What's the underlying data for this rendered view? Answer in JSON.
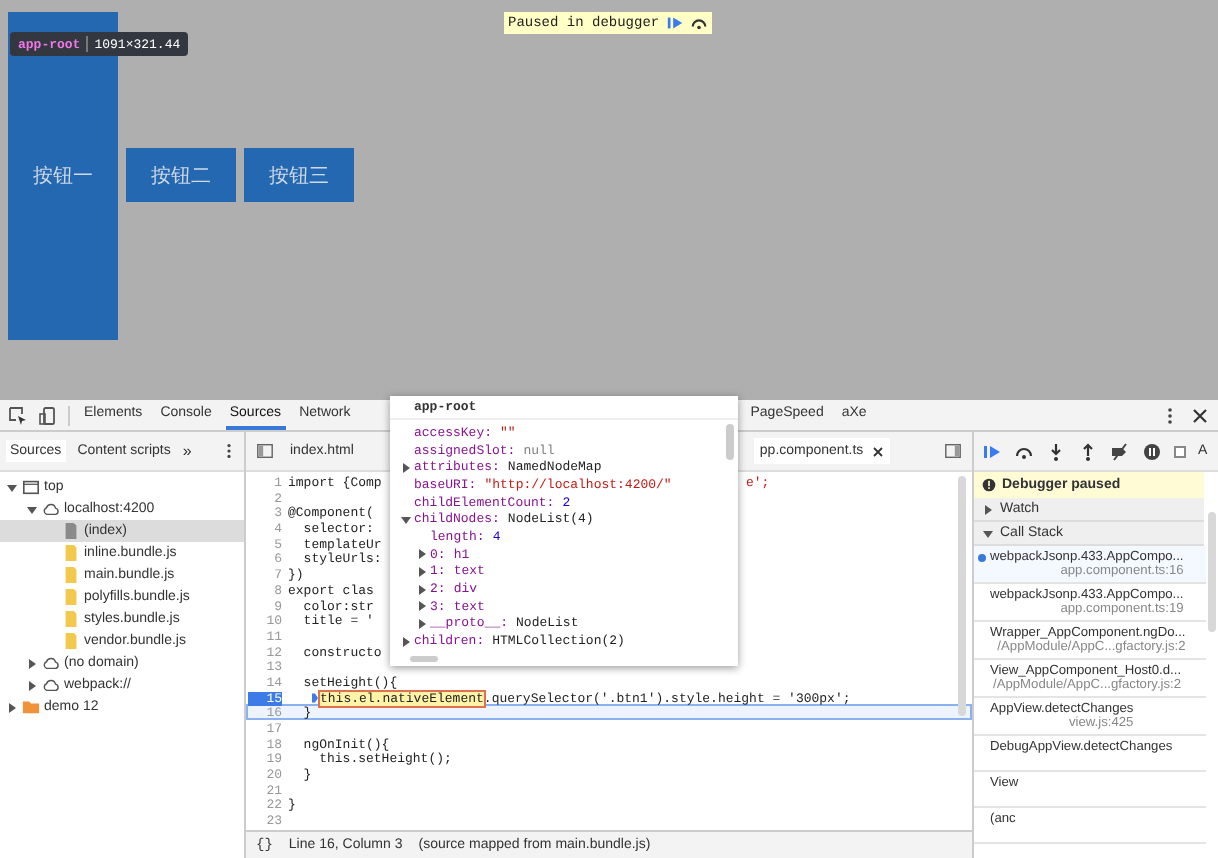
{
  "page": {
    "debug_badge": {
      "text": "Paused in debugger"
    },
    "element_tooltip": {
      "tag": "app-root",
      "size": "1091×321.44"
    },
    "buttons": [
      {
        "label": "按钮一",
        "kind": "tall"
      },
      {
        "label": "按钮二",
        "kind": "short"
      },
      {
        "label": "按钮三",
        "kind": "short"
      }
    ]
  },
  "devtools": {
    "tabs": [
      {
        "label": "Elements",
        "selected": false
      },
      {
        "label": "Console",
        "selected": false
      },
      {
        "label": "Sources",
        "selected": true
      },
      {
        "label": "Network",
        "selected": false
      },
      {
        "label": "PageSpeed",
        "selected": false
      },
      {
        "label": "aXe",
        "selected": false
      }
    ],
    "navigator": {
      "tabs": [
        {
          "label": "Sources",
          "selected": true
        },
        {
          "label": "Content scripts",
          "selected": false
        }
      ],
      "more": "»",
      "tree": [
        {
          "label": "top",
          "kind": "frame",
          "expanded": true,
          "selected": false,
          "children": [
            {
              "label": "localhost:4200",
              "kind": "cloud",
              "expanded": true,
              "selected": false,
              "children": [
                {
                  "label": "(index)",
                  "kind": "page",
                  "selected": true
                },
                {
                  "label": "inline.bundle.js",
                  "kind": "script",
                  "selected": false
                },
                {
                  "label": "main.bundle.js",
                  "kind": "script",
                  "selected": false
                },
                {
                  "label": "polyfills.bundle.js",
                  "kind": "script",
                  "selected": false
                },
                {
                  "label": "styles.bundle.js",
                  "kind": "script",
                  "selected": false
                },
                {
                  "label": "vendor.bundle.js",
                  "kind": "script",
                  "selected": false
                }
              ]
            },
            {
              "label": "(no domain)",
              "kind": "cloud",
              "expanded": false,
              "selected": false
            },
            {
              "label": "webpack://",
              "kind": "cloud",
              "expanded": false,
              "selected": false
            }
          ]
        },
        {
          "label": "demo 12",
          "kind": "folder",
          "expanded": false,
          "selected": false
        }
      ]
    },
    "editor": {
      "tabs": [
        {
          "label": "index.html",
          "selected": false
        },
        {
          "label": "pp.component.ts",
          "selected": true
        }
      ],
      "lines": [
        {
          "num": "1",
          "text": "import {Comp",
          "tail": "e';",
          "breakpoint": false,
          "current": false
        },
        {
          "num": "2",
          "breakpoint": false,
          "current": false
        },
        {
          "num": "3",
          "text": "@Component(",
          "breakpoint": false,
          "current": false
        },
        {
          "num": "4",
          "text": "  selector:",
          "breakpoint": false,
          "current": false
        },
        {
          "num": "5",
          "text": "  templateUr",
          "breakpoint": false,
          "current": false
        },
        {
          "num": "6",
          "text": "  styleUrls:",
          "breakpoint": false,
          "current": false
        },
        {
          "num": "7",
          "text": "})",
          "breakpoint": false,
          "current": false
        },
        {
          "num": "8",
          "text": "export clas",
          "breakpoint": false,
          "current": false
        },
        {
          "num": "9",
          "text": "  color:str",
          "breakpoint": false,
          "current": false
        },
        {
          "num": "10",
          "text": "  title = '",
          "breakpoint": false,
          "current": false
        },
        {
          "num": "11",
          "breakpoint": false,
          "current": false
        },
        {
          "num": "12",
          "text": "  constructo",
          "breakpoint": false,
          "current": false
        },
        {
          "num": "13",
          "breakpoint": false,
          "current": false
        },
        {
          "num": "14",
          "text": "  setHeight(){",
          "breakpoint": false,
          "current": false
        },
        {
          "num": "15",
          "highlight": "this.el.nativeElement",
          "text": ".querySelector('.btn1').style.height = '300px';",
          "breakpoint": true,
          "current": false
        },
        {
          "num": "16",
          "text": "  }",
          "breakpoint": false,
          "current": true
        },
        {
          "num": "17",
          "breakpoint": false,
          "current": false
        },
        {
          "num": "18",
          "text": "  ngOnInit(){",
          "breakpoint": false,
          "current": false
        },
        {
          "num": "19",
          "text": "    this.setHeight();",
          "breakpoint": false,
          "current": false
        },
        {
          "num": "20",
          "text": "  }",
          "breakpoint": false,
          "current": false
        },
        {
          "num": "21",
          "breakpoint": false,
          "current": false
        },
        {
          "num": "22",
          "text": "}",
          "breakpoint": false,
          "current": false
        },
        {
          "num": "23",
          "breakpoint": false,
          "current": false
        }
      ],
      "status": {
        "braces": "{}",
        "position": "Line 16, Column 3",
        "source": "(source mapped from main.bundle.js)"
      }
    },
    "popover": {
      "title": "app-root",
      "properties": [
        {
          "name": "accessKey:",
          "value": "\"\"",
          "kind": "string"
        },
        {
          "name": "assignedSlot:",
          "value": "null",
          "kind": "null"
        },
        {
          "name": "attributes:",
          "value": "NamedNodeMap",
          "kind": "object",
          "expanded": false
        },
        {
          "name": "baseURI:",
          "value": "\"http://localhost:4200/\"",
          "kind": "string"
        },
        {
          "name": "childElementCount:",
          "value": "2",
          "kind": "number"
        },
        {
          "name": "childNodes:",
          "value": "NodeList(4)",
          "kind": "object",
          "expanded": true,
          "children": [
            {
              "name": "length:",
              "value": "4",
              "kind": "number"
            },
            {
              "name": "0:",
              "value": "h1",
              "kind": "node",
              "expanded": false
            },
            {
              "name": "1:",
              "value": "text",
              "kind": "node",
              "expanded": false
            },
            {
              "name": "2:",
              "value": "div",
              "kind": "node",
              "expanded": false
            },
            {
              "name": "3:",
              "value": "text",
              "kind": "node",
              "expanded": false
            },
            {
              "name": "__proto__:",
              "value": "NodeList",
              "kind": "object",
              "expanded": false
            }
          ]
        },
        {
          "name": "children:",
          "value": "HTMLCollection(2)",
          "kind": "object",
          "expanded": false
        }
      ]
    },
    "debugger": {
      "async_label": "A",
      "async_checked": false,
      "banner": "Debugger paused",
      "sections": [
        {
          "label": "Watch",
          "expanded": false
        },
        {
          "label": "Call Stack",
          "expanded": true
        }
      ],
      "frames": [
        {
          "name": "webpackJsonp.433.AppCompo...",
          "location": "app.component.ts:16",
          "selected": true
        },
        {
          "name": "webpackJsonp.433.AppCompo...",
          "location": "app.component.ts:19",
          "selected": false
        },
        {
          "name": "Wrapper_AppComponent.ngDo...",
          "location": "/AppModule/AppC...gfactory.js:2",
          "selected": false
        },
        {
          "name": "View_AppComponent_Host0.d...",
          "location": "/AppModule/AppC...gfactory.js:2",
          "selected": false
        },
        {
          "name": "AppView.detectChanges",
          "location": "view.js:425",
          "selected": false
        },
        {
          "name": "DebugAppView.detectChanges",
          "selected": false
        },
        {
          "name": "View",
          "selected": false
        },
        {
          "name": "(anc",
          "selected": false
        }
      ]
    }
  }
}
